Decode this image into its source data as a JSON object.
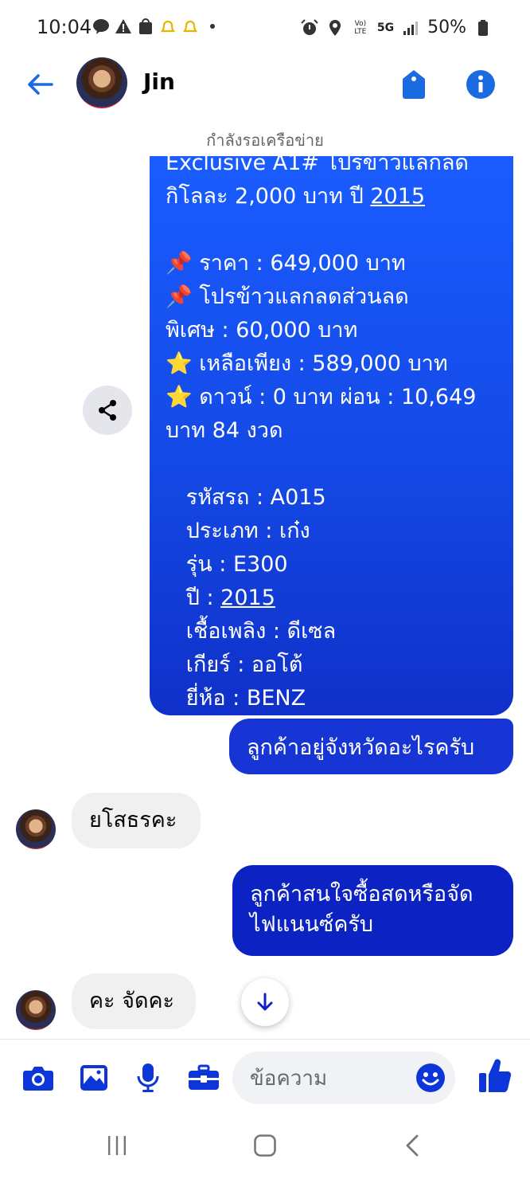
{
  "status_bar": {
    "time": "10:04",
    "network": "5G",
    "battery": "50%"
  },
  "header": {
    "contact_name": "Jin"
  },
  "conversation": {
    "network_status": "กำลังรอเครือข่าย",
    "big_message": {
      "lines": [
        {
          "text": "Exclusive A1# โปรข้าวแลกลด",
          "underline": null
        },
        {
          "text": "กิโลละ 2,000 บาท ปี ",
          "underline": "2015"
        },
        {
          "text": "",
          "underline": null
        },
        {
          "text": "📌 ราคา : 649,000 บาท",
          "underline": null
        },
        {
          "text": "📌 โปรข้าวแลกลดส่วนลด",
          "underline": null
        },
        {
          "text": "พิเศษ : 60,000 บาท",
          "underline": null
        },
        {
          "text": "⭐ เหลือเพียง : 589,000 บาท",
          "underline": null
        },
        {
          "text": "⭐ ดาวน์ : 0 บาท ผ่อน : 10,649",
          "underline": null
        },
        {
          "text": "บาท 84 งวด",
          "underline": null
        },
        {
          "text": "",
          "underline": null
        },
        {
          "text": "   รหัสรถ : A015",
          "underline": null
        },
        {
          "text": "   ประเภท : เก๋ง",
          "underline": null
        },
        {
          "text": "   รุ่น : E300",
          "underline": null
        },
        {
          "text": "   ปี : ",
          "underline": "2015"
        },
        {
          "text": "   เชื้อเพลิง : ดีเซล",
          "underline": null
        },
        {
          "text": "   เกียร์ : ออโต้",
          "underline": null
        },
        {
          "text": "   ยี่ห้อ : BENZ",
          "underline": null
        }
      ]
    },
    "outgoing_1": "ลูกค้าอยู่จังหวัดอะไรครับ",
    "incoming_1": "ยโสธรคะ",
    "outgoing_2": "ลูกค้าสนใจซื้อสดหรือจัดไฟแนนซ์ครับ",
    "incoming_2": "คะ จัดคะ"
  },
  "composer": {
    "placeholder": "ข้อความ"
  },
  "colors": {
    "accent": "#1a6ae0",
    "bubble_blue_top": "#1a5cff",
    "bubble_blue_bottom": "#0c22c2",
    "incoming_bubble": "#f0f0f0"
  },
  "icons": [
    "back-arrow-icon",
    "tag-icon",
    "info-icon",
    "share-icon",
    "arrow-down-icon",
    "camera-icon",
    "image-icon",
    "microphone-icon",
    "briefcase-icon",
    "emoji-icon",
    "thumbs-up-icon",
    "recent-apps-icon",
    "home-icon",
    "back-icon"
  ]
}
